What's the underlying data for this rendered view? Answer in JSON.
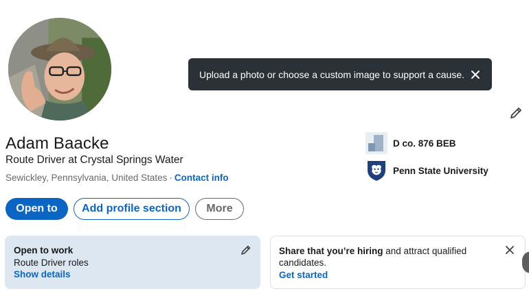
{
  "profile": {
    "name": "Adam Baacke",
    "headline": "Route Driver at Crystal Springs Water",
    "location": "Sewickley, Pennsylvania, United States",
    "separator": "·",
    "contact_info": "Contact info"
  },
  "tooltip": {
    "text": "Upload a photo or choose a custom image to support a cause."
  },
  "orgs": {
    "company": "D co. 876 BEB",
    "school": "Penn State University"
  },
  "actions": {
    "open_to": "Open to",
    "add_section": "Add profile section",
    "more": "More"
  },
  "open_to_work": {
    "title": "Open to work",
    "roles": "Route Driver roles",
    "link": "Show details"
  },
  "hiring": {
    "strong": "Share that you’re hiring",
    "rest": " and attract qualified candidates.",
    "link": "Get started"
  },
  "colors": {
    "brand": "#0a66c2",
    "tooltip_bg": "#2b3237",
    "otw_card_bg": "#dde7f1"
  },
  "icons": [
    "pencil-icon",
    "close-icon",
    "company-logo",
    "penn-state-logo"
  ]
}
